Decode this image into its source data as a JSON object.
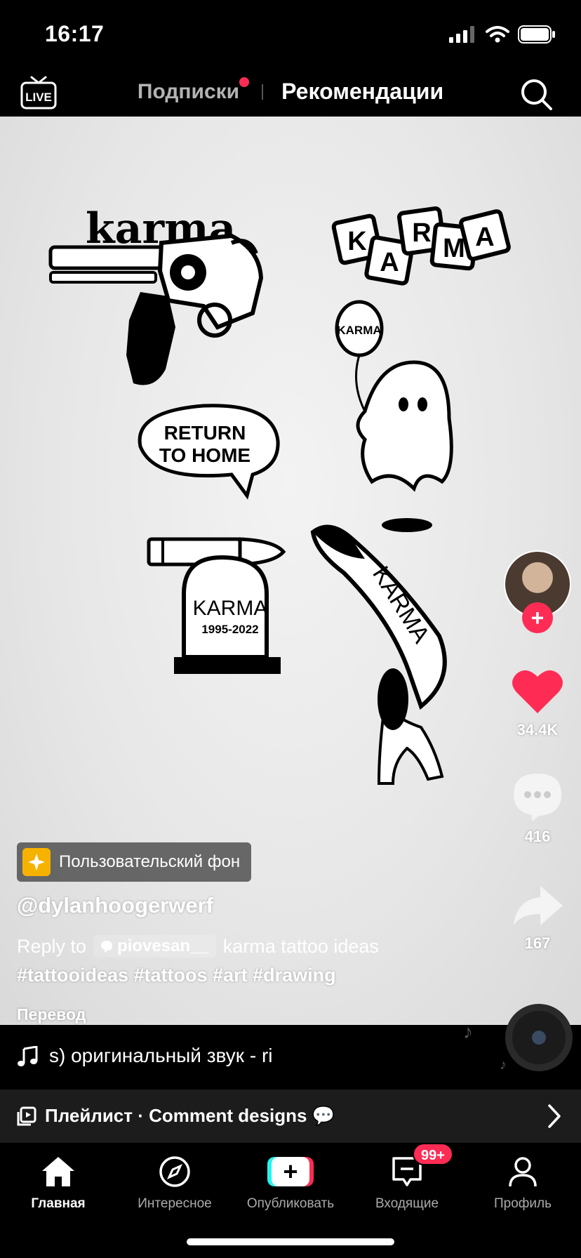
{
  "status_bar": {
    "time": "16:17"
  },
  "top_nav": {
    "tab_following": "Подписки",
    "tab_for_you": "Рекомендации"
  },
  "video": {
    "sticker_texts": [
      "karma",
      "KARMA",
      "KARMA",
      "RETURN",
      "TO HOME",
      "KARMA",
      "1995-2022",
      "KARMA"
    ]
  },
  "actions": {
    "likes": "34.4K",
    "comments": "416",
    "shares": "167"
  },
  "caption": {
    "background_chip": "Пользовательский фон",
    "username": "@dylanhoogerwerf",
    "reply_prefix": "Reply to",
    "reply_user": "piovesan__",
    "reply_text": "karma tattoo ideas",
    "hashtags": "#tattooideas #tattoos #art #drawing",
    "translate": "Перевод"
  },
  "sound": {
    "text": "s)    оригинальный звук - ri"
  },
  "playlist": {
    "text": "Плейлист · Comment designs 💬"
  },
  "tab_bar": {
    "home": "Главная",
    "discover": "Интересное",
    "publish": "Опубликовать",
    "inbox": "Входящие",
    "profile": "Профиль",
    "inbox_badge": "99+"
  },
  "colors": {
    "accent": "#fe2c55",
    "cyan": "#25f4ee",
    "chip": "#f5b300"
  }
}
